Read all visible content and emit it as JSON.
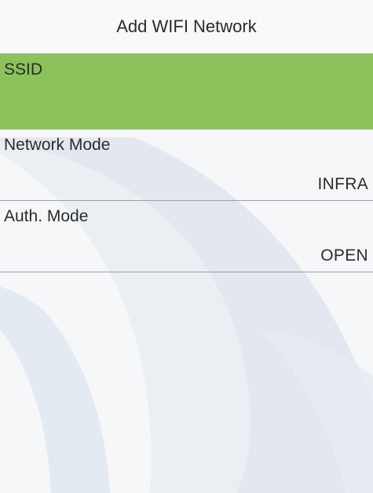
{
  "header": {
    "title": "Add WIFI Network"
  },
  "fields": [
    {
      "label": "SSID",
      "value": ""
    },
    {
      "label": "Network Mode",
      "value": "INFRA"
    },
    {
      "label": "Auth. Mode",
      "value": "OPEN"
    }
  ],
  "colors": {
    "selected_row": "#8cc25c",
    "watermark": "#dde3ec"
  },
  "icons": {
    "watermark": "logo-watermark"
  }
}
